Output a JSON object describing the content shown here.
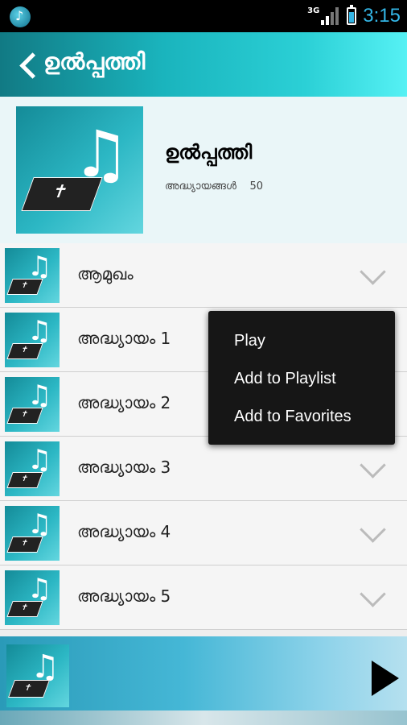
{
  "status_bar": {
    "network": "3G",
    "time": "3:15"
  },
  "header": {
    "title": "ഉൽപ്പത്തി"
  },
  "book": {
    "title": "ഉൽപ്പത്തി",
    "chapters_label": "അദ്ധ്യായങ്ങൾ",
    "chapters_count": "50"
  },
  "list": [
    {
      "label": "ആമുഖം"
    },
    {
      "label": "അദ്ധ്യായം 1"
    },
    {
      "label": "അദ്ധ്യായം 2"
    },
    {
      "label": "അദ്ധ്യായം 3"
    },
    {
      "label": "അദ്ധ്യായം 4"
    },
    {
      "label": "അദ്ധ്യായം 5"
    }
  ],
  "menu": {
    "play": "Play",
    "add_playlist": "Add to Playlist",
    "add_favorites": "Add to Favorites"
  },
  "colors": {
    "accent": "#1ab4bd",
    "status_time": "#33b5e5",
    "menu_bg": "#161616"
  },
  "icons": [
    "app-music-icon",
    "signal-icon",
    "battery-icon",
    "back-icon",
    "chevron-down-icon",
    "play-icon",
    "music-bible-icon"
  ]
}
